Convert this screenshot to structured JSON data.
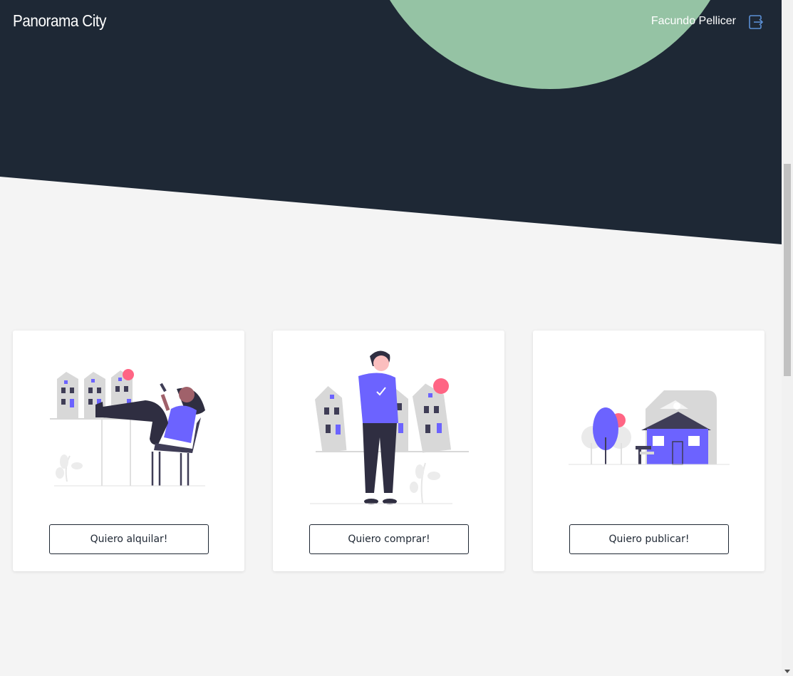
{
  "header": {
    "brand": "Panorama City",
    "user_name": "Facundo Pellicer",
    "logout_icon": "logout-icon"
  },
  "colors": {
    "dark_bg": "#1e2835",
    "accent_green": "#95c3a4",
    "accent_purple": "#6c63ff",
    "accent_red": "#ff6584",
    "page_bg": "#f4f4f4"
  },
  "cards": [
    {
      "illustration": "woman-relaxing-with-houses",
      "button_label": "Quiero alquilar!"
    },
    {
      "illustration": "man-with-houses-checkmark",
      "button_label": "Quiero comprar!"
    },
    {
      "illustration": "house-with-trees",
      "button_label": "Quiero publicar!"
    }
  ]
}
